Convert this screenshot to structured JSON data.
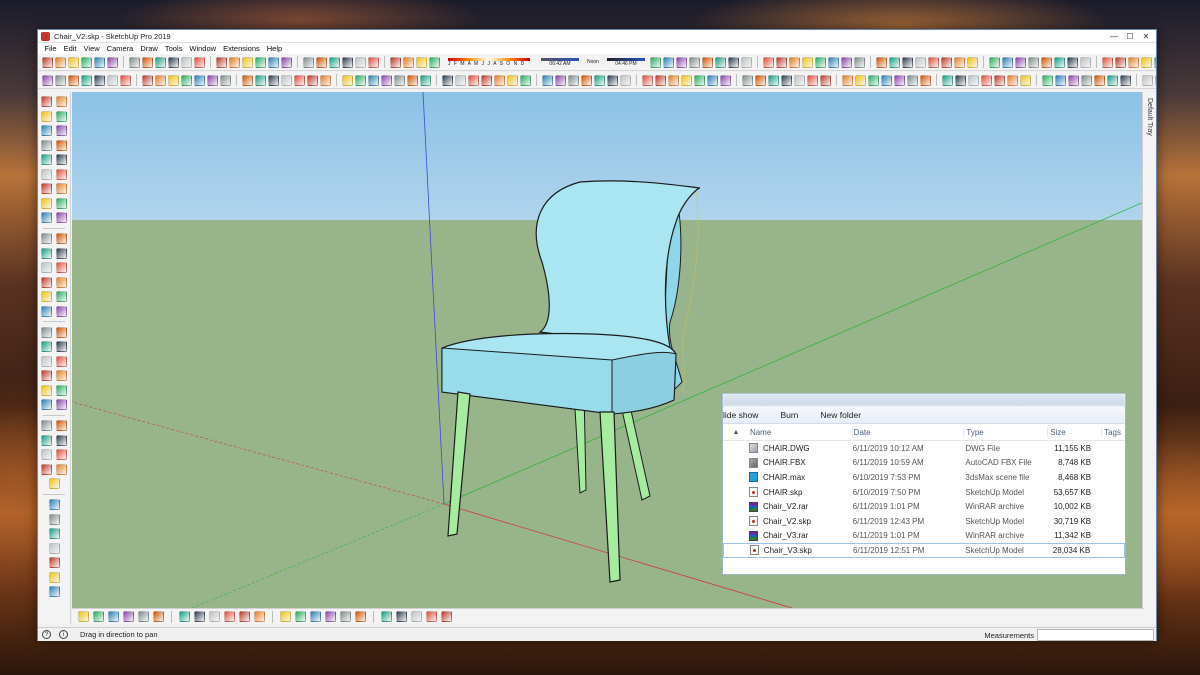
{
  "window": {
    "title": "Chair_V2.skp - SketchUp Pro 2019",
    "controls": [
      "—",
      "☐",
      "✕"
    ]
  },
  "menu": [
    "File",
    "Edit",
    "View",
    "Camera",
    "Draw",
    "Tools",
    "Window",
    "Extensions",
    "Help"
  ],
  "shadows": {
    "months": "J F M A M J J A S O N D",
    "time_start": "06:42 AM",
    "time_noon": "Noon",
    "time_end": "04:46 PM"
  },
  "tray": {
    "label": "Default Tray"
  },
  "status": {
    "hint": "Drag in direction to pan",
    "measurements_label": "Measurements",
    "measurements_value": ""
  },
  "explorer": {
    "toolbar": [
      "lide show",
      "Burn",
      "New folder"
    ],
    "columns": {
      "name": "Name",
      "date": "Date",
      "type": "Type",
      "size": "Size",
      "tags": "Tags"
    },
    "files": [
      {
        "name": "CHAIR.DWG",
        "date": "6/11/2019 10:12 AM",
        "type": "DWG File",
        "size": "11,155 KB",
        "icon": "dwg"
      },
      {
        "name": "CHAIR.FBX",
        "date": "6/11/2019 10:59 AM",
        "type": "AutoCAD FBX File",
        "size": "8,748 KB",
        "icon": "fbx"
      },
      {
        "name": "CHAIR.max",
        "date": "6/10/2019 7:53 PM",
        "type": "3dsMax scene file",
        "size": "8,468 KB",
        "icon": "max"
      },
      {
        "name": "CHAIR.skp",
        "date": "6/10/2019 7:50 PM",
        "type": "SketchUp Model",
        "size": "53,657 KB",
        "icon": "skp"
      },
      {
        "name": "Chair_V2.rar",
        "date": "6/11/2019 1:01 PM",
        "type": "WinRAR archive",
        "size": "10,002 KB",
        "icon": "rar"
      },
      {
        "name": "Chair_V2.skp",
        "date": "6/11/2019 12:43 PM",
        "type": "SketchUp Model",
        "size": "30,719 KB",
        "icon": "skp"
      },
      {
        "name": "Chair_V3.rar",
        "date": "6/11/2019 1:01 PM",
        "type": "WinRAR archive",
        "size": "11,342 KB",
        "icon": "rar"
      },
      {
        "name": "Chair_V3.skp",
        "date": "6/11/2019 12:51 PM",
        "type": "SketchUp Model",
        "size": "28,034 KB",
        "icon": "skp"
      }
    ]
  },
  "colors": {
    "sky": "#b7d8ee",
    "ground": "#98b48a",
    "chair_body": "#a9e6f2",
    "chair_legs": "#a6eba0",
    "axis_red": "#d23b3b",
    "axis_green": "#2fb53a",
    "axis_blue": "#3b4ad2"
  }
}
